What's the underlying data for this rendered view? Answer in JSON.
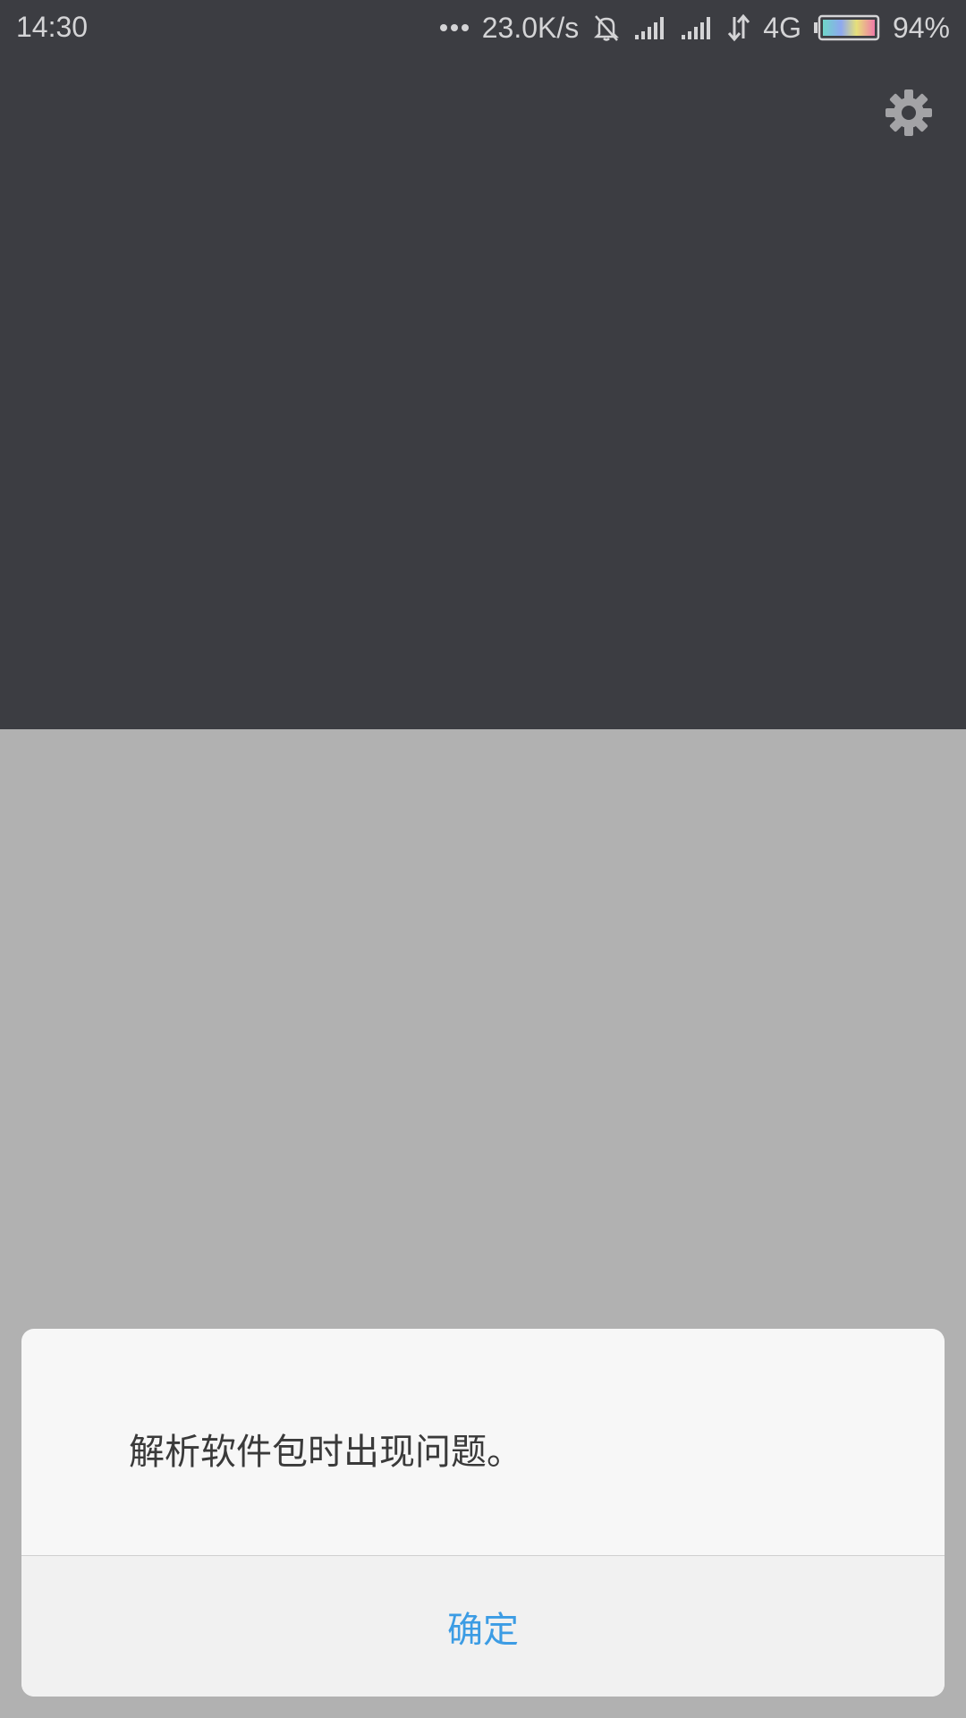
{
  "statusbar": {
    "time": "14:30",
    "more_icon": "more-dots-icon",
    "net_speed": "23.0K/s",
    "mute_icon": "bell-off-icon",
    "signal_icon": "signal-bars-icon",
    "data_icon": "data-transfer-icon",
    "network": "4G",
    "battery_icon": "battery-icon",
    "battery": "94%"
  },
  "header": {
    "settings_icon": "gear-icon"
  },
  "dialog": {
    "message": "解析软件包时出现问题。",
    "ok_label": "确定"
  },
  "colors": {
    "top_background": "#3c3d42",
    "overlay_background": "#b1b1b1",
    "dialog_background": "#f7f7f7",
    "button_text": "#3c9ce4",
    "message_text": "#3a3a3a"
  }
}
